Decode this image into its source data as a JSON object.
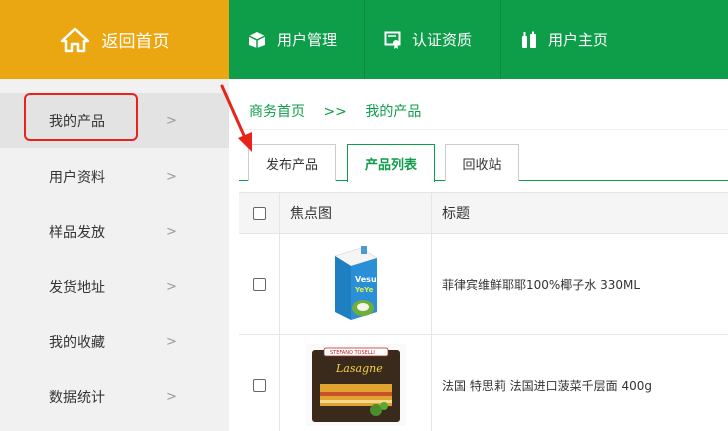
{
  "topbar": {
    "home_label": "返回首页",
    "nav": [
      {
        "label": "用户管理",
        "icon": "box-icon"
      },
      {
        "label": "认证资质",
        "icon": "certificate-icon"
      },
      {
        "label": "用户主页",
        "icon": "bottles-icon"
      }
    ]
  },
  "sidebar": {
    "items": [
      {
        "label": "我的产品"
      },
      {
        "label": "用户资料"
      },
      {
        "label": "样品发放"
      },
      {
        "label": "发货地址"
      },
      {
        "label": "我的收藏"
      },
      {
        "label": "数据统计"
      }
    ],
    "chevron": ">"
  },
  "breadcrumb": {
    "home": "商务首页",
    "separator": ">>",
    "current": "我的产品"
  },
  "tabs": [
    {
      "label": "发布产品"
    },
    {
      "label": "产品列表"
    },
    {
      "label": "回收站"
    }
  ],
  "table": {
    "headers": {
      "image": "焦点图",
      "title": "标题"
    },
    "rows": [
      {
        "title": "菲律宾维鲜耶耶100%椰子水 330ML",
        "image": "coconut-water-carton"
      },
      {
        "title": "法国 特思莉 法国进口菠菜千层面 400g",
        "image": "lasagna-box"
      }
    ]
  },
  "colors": {
    "green": "#0e9e4a",
    "orange": "#eba712",
    "highlight_red": "#e8231c"
  }
}
